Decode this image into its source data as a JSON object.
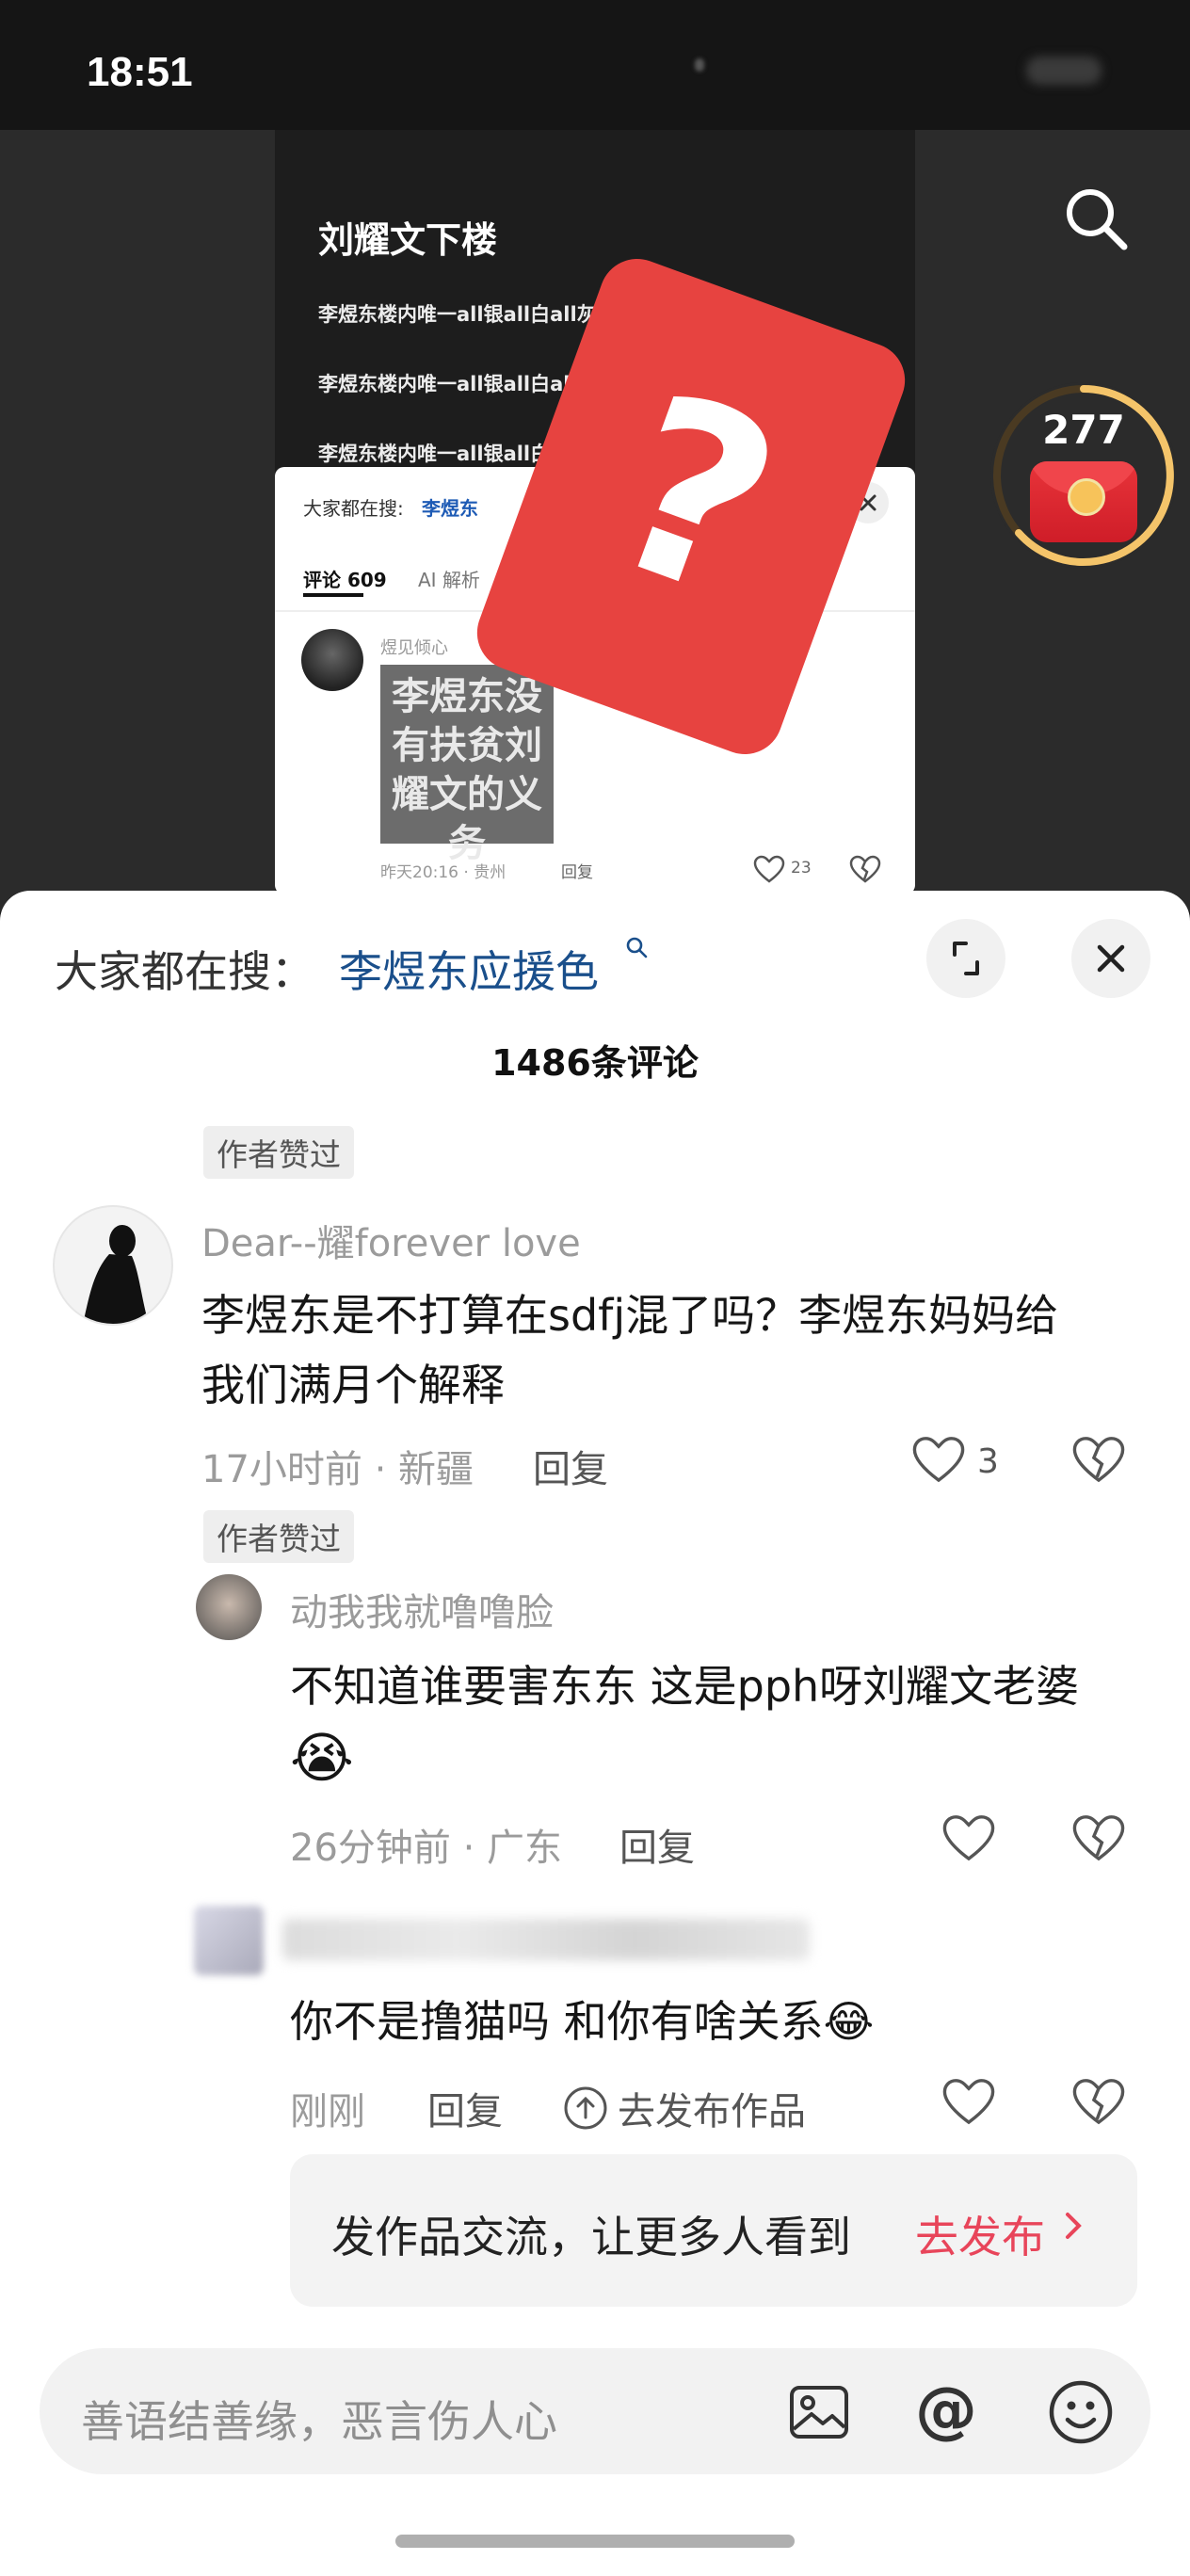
{
  "status": {
    "time": "18:51"
  },
  "video": {
    "title": "刘耀文下楼",
    "lines": [
      "李煜东楼内唯一all银all白all灰",
      "李煜东楼内唯一all银all白all灰",
      "李煜东楼内唯一all银all白all灰"
    ],
    "red_packet_count": "277",
    "embedded": {
      "search_label": "大家都在搜:",
      "search_term": "李煜东",
      "tab_comments": "评论 609",
      "tab_ai": "AI 解析",
      "user": "煜见倾心",
      "image_text": "李煜东没有扶贫刘耀文的义务",
      "meta": "昨天20:16 · 贵州",
      "reply": "回复",
      "likes": "23"
    },
    "question_mark": "?"
  },
  "sheet": {
    "search_prefix": "大家都在搜：",
    "search_term": "李煜东应援色",
    "comment_count": "1486条评论"
  },
  "comments": [
    {
      "badge": "作者赞过",
      "user": "Dear--耀forever love",
      "text_line1": "李煜东是不打算在sdfj混了吗？李煜东妈妈给",
      "text_line2": "我们满月个解释",
      "meta": "17小时前 · 新疆",
      "reply": "回复",
      "likes": "3"
    },
    {
      "badge": "作者赞过",
      "user": "动我我就噜噜脸",
      "text_line1": "不知道谁要害东东 这是pph呀刘耀文老婆",
      "emoji": "😭",
      "meta": "26分钟前 · 广东",
      "reply": "回复"
    },
    {
      "text_line1": "你不是撸猫吗 和你有啥关系😂",
      "meta": "刚刚",
      "reply": "回复",
      "publish": "去发布作品"
    }
  ],
  "promo": {
    "text": "发作品交流，让更多人看到",
    "action": "去发布"
  },
  "input": {
    "placeholder": "善语结善缘，恶言伤人心"
  },
  "colors": {
    "accent_blue": "#1a4f8b",
    "promo_red": "#e8455a",
    "question_card": "#e74340"
  }
}
